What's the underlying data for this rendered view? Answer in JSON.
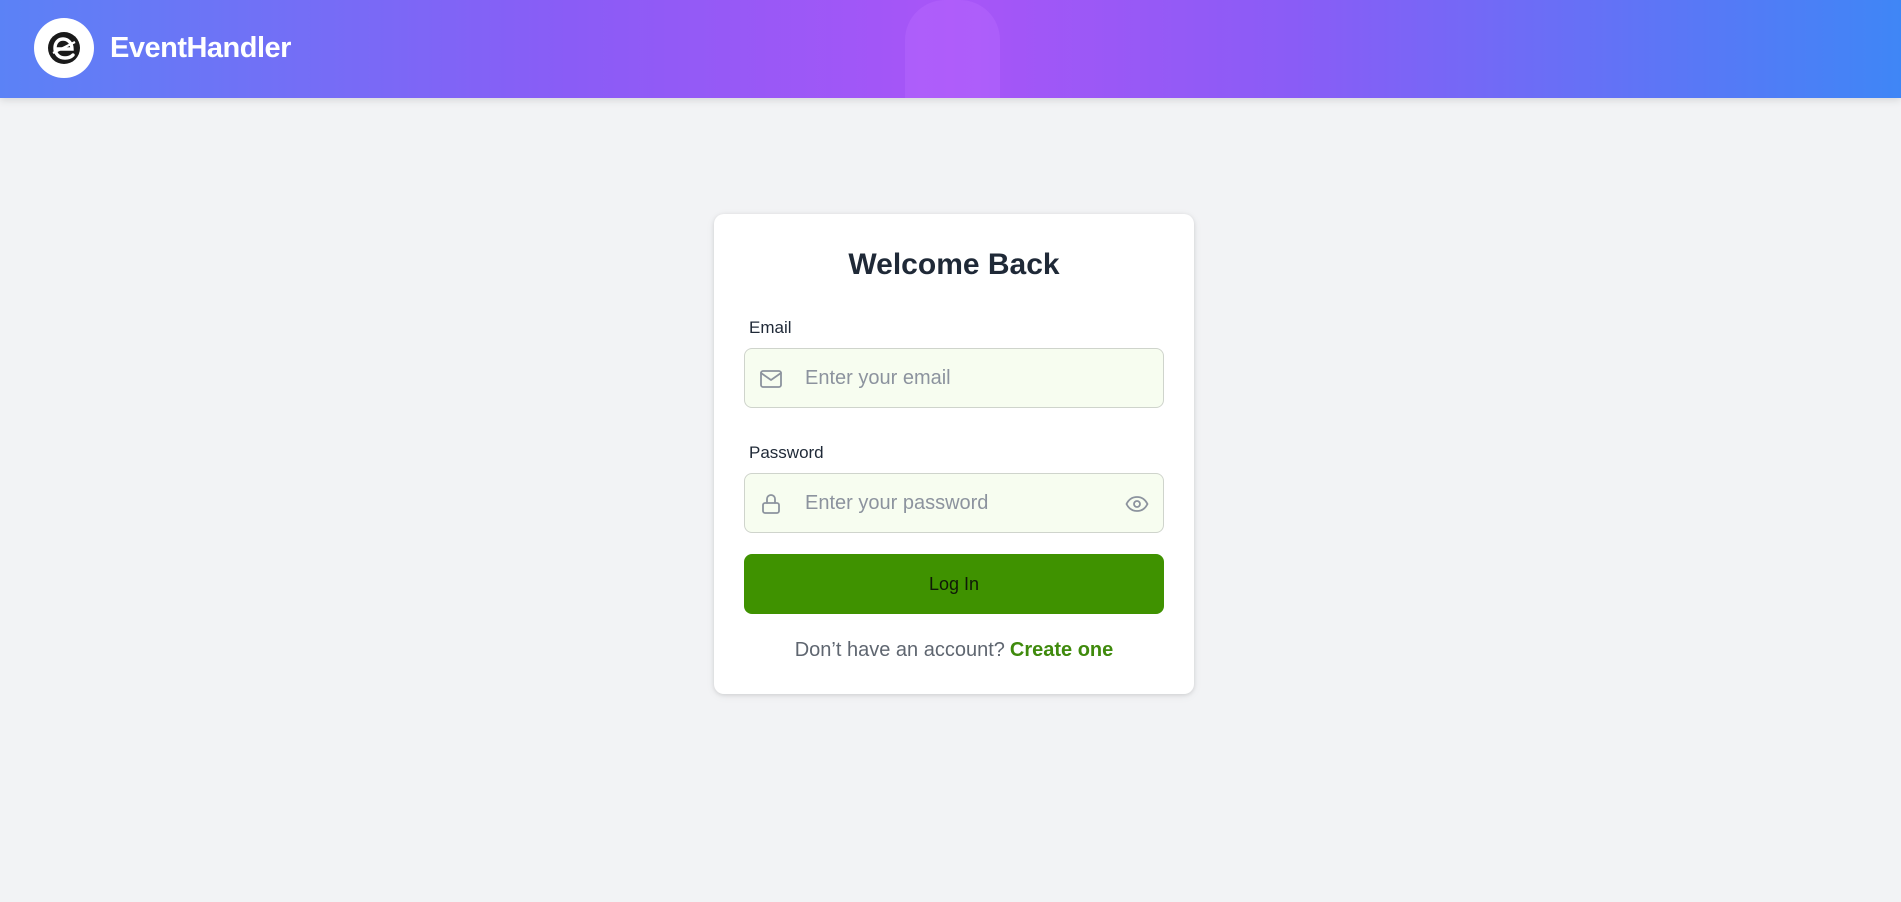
{
  "header": {
    "brand_name": "EventHandler",
    "logo_icon": "e-logo-icon"
  },
  "login": {
    "title": "Welcome Back",
    "email": {
      "label": "Email",
      "placeholder": "Enter your email",
      "value": "",
      "icon": "mail-icon"
    },
    "password": {
      "label": "Password",
      "placeholder": "Enter your password",
      "value": "",
      "icon": "lock-icon",
      "toggle_icon": "eye-icon"
    },
    "submit_label": "Log In",
    "signup_prompt": "Don’t have an account?",
    "signup_link": "Create one"
  },
  "colors": {
    "header_gradient_start": "#5b82f6",
    "header_gradient_mid": "#a855f7",
    "header_gradient_end": "#3f86f6",
    "primary_button": "#3f9200",
    "link": "#3f8a0c",
    "input_background": "#f7fdf0",
    "page_background": "#f2f3f5"
  }
}
